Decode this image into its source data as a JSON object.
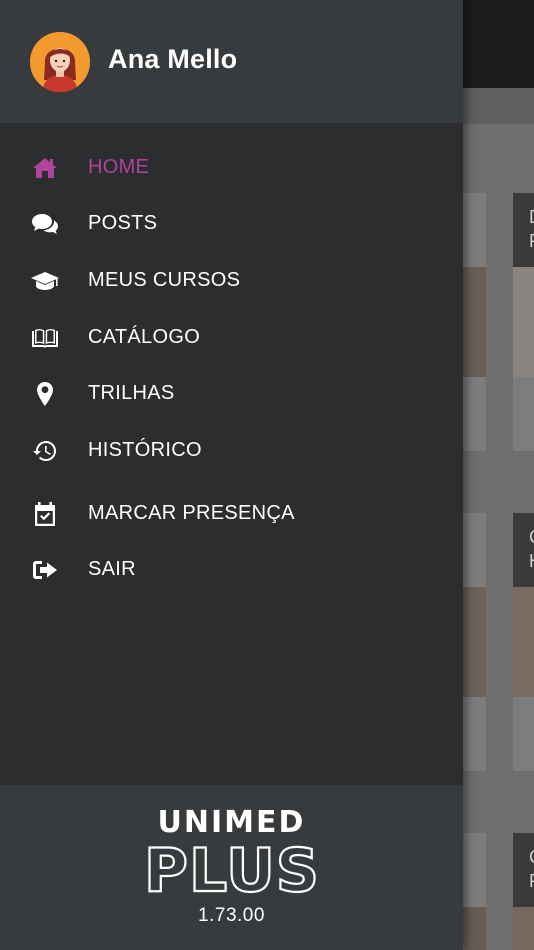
{
  "user": {
    "name": "Ana Mello"
  },
  "menu": {
    "active_color": "#b0439c",
    "items": [
      {
        "label": "HOME",
        "icon": "home-icon",
        "active": true
      },
      {
        "label": "POSTS",
        "icon": "comments-icon",
        "active": false
      },
      {
        "label": "MEUS CURSOS",
        "icon": "graduation-cap-icon",
        "active": false
      },
      {
        "label": "CATÁLOGO",
        "icon": "open-book-icon",
        "active": false
      },
      {
        "label": "TRILHAS",
        "icon": "map-marker-icon",
        "active": false
      },
      {
        "label": "HISTÓRICO",
        "icon": "history-icon",
        "active": false
      },
      {
        "label": "MARCAR PRESENÇA",
        "icon": "calendar-check-icon",
        "active": false
      },
      {
        "label": "SAIR",
        "icon": "sign-out-icon",
        "active": false
      }
    ]
  },
  "footer": {
    "logo_line1": "UNIMED",
    "logo_line2": "PLUS",
    "version": "1.73.00"
  },
  "background": {
    "cards": [
      {
        "text": "D\nP"
      },
      {
        "text": "C\nH"
      },
      {
        "text": "C\nP"
      }
    ]
  }
}
